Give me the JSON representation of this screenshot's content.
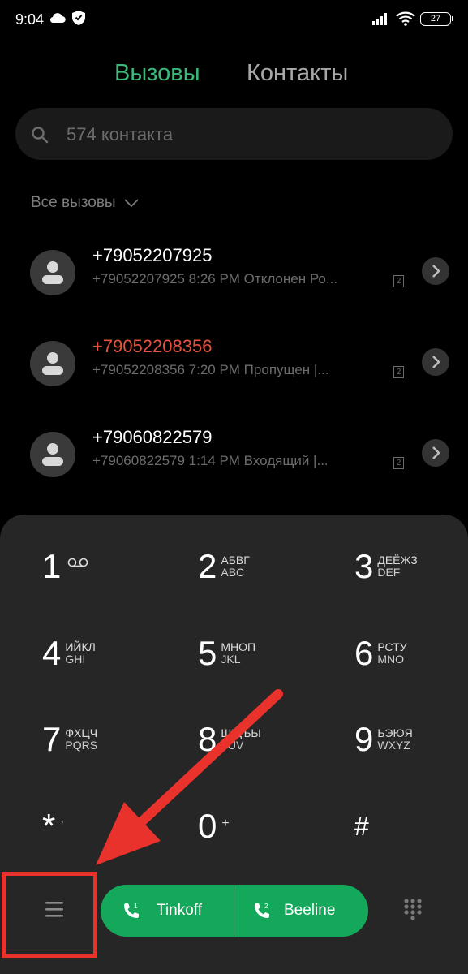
{
  "status_bar": {
    "time": "9:04",
    "battery": "27"
  },
  "tabs": {
    "calls": "Вызовы",
    "contacts": "Контакты"
  },
  "search": {
    "placeholder": "574 контакта"
  },
  "filter": {
    "label": "Все вызовы"
  },
  "calls": [
    {
      "number": "+79052207925",
      "details": "+79052207925  8:26 PM  Отклонен  Ро...",
      "sim": "2",
      "missed": false
    },
    {
      "number": "+79052208356",
      "details": "+79052208356  7:20 PM  Пропущен |...",
      "sim": "2",
      "missed": true
    },
    {
      "number": "+79060822579",
      "details": "+79060822579  1:14 PM  Входящий |...",
      "sim": "2",
      "missed": false
    }
  ],
  "keypad": {
    "k1": {
      "digit": "1"
    },
    "k2": {
      "digit": "2",
      "cyr": "АБВГ",
      "lat": "ABC"
    },
    "k3": {
      "digit": "3",
      "cyr": "ДЕЁЖЗ",
      "lat": "DEF"
    },
    "k4": {
      "digit": "4",
      "cyr": "ИЙКЛ",
      "lat": "GHI"
    },
    "k5": {
      "digit": "5",
      "cyr": "МНОП",
      "lat": "JKL"
    },
    "k6": {
      "digit": "6",
      "cyr": "РСТУ",
      "lat": "MNO"
    },
    "k7": {
      "digit": "7",
      "cyr": "ФХЦЧ",
      "lat": "PQRS"
    },
    "k8": {
      "digit": "8",
      "cyr": "ШЩЪЫ",
      "lat": "TUV"
    },
    "k9": {
      "digit": "9",
      "cyr": "ЬЭЮЯ",
      "lat": "WXYZ"
    },
    "kstar": {
      "digit": "*",
      "extra": ","
    },
    "k0": {
      "digit": "0",
      "extra": "+"
    },
    "khash": {
      "digit": "#"
    }
  },
  "call_buttons": {
    "sim1": {
      "label": "Tinkoff",
      "index": "1"
    },
    "sim2": {
      "label": "Beeline",
      "index": "2"
    }
  },
  "colors": {
    "accent": "#3cb87a",
    "missed": "#e5533d",
    "call_button": "#14a85a",
    "annotation": "#e8322b"
  }
}
